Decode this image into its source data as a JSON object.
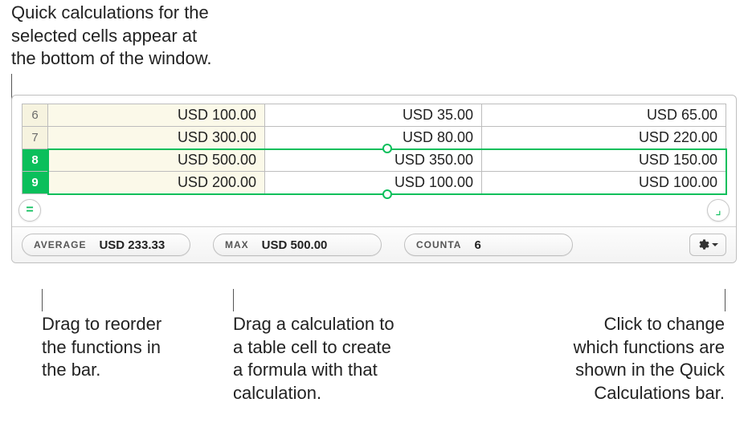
{
  "callouts": {
    "top": "Quick calculations for the\nselected cells appear at\nthe bottom of the window.",
    "reorder": "Drag to reorder\nthe functions in\nthe bar.",
    "drag_formula": "Drag a calculation to\na table cell to create\na formula with that\ncalculation.",
    "gear": "Click to change\nwhich functions are\nshown in the Quick\nCalculations bar."
  },
  "rows": [
    {
      "num": "6",
      "c1": "USD 100.00",
      "c2": "USD 35.00",
      "c3": "USD 65.00",
      "selected": false
    },
    {
      "num": "7",
      "c1": "USD 300.00",
      "c2": "USD 80.00",
      "c3": "USD 220.00",
      "selected": false
    },
    {
      "num": "8",
      "c1": "USD 500.00",
      "c2": "USD 350.00",
      "c3": "USD 150.00",
      "selected": true
    },
    {
      "num": "9",
      "c1": "USD 200.00",
      "c2": "USD 100.00",
      "c3": "USD 100.00",
      "selected": true
    }
  ],
  "calc_bar": {
    "items": [
      {
        "label": "AVERAGE",
        "value": "USD 233.33"
      },
      {
        "label": "MAX",
        "value": "USD 500.00"
      },
      {
        "label": "COUNTA",
        "value": "6"
      }
    ]
  },
  "buttons": {
    "equals": "=",
    "corner_rb": "⌟"
  }
}
